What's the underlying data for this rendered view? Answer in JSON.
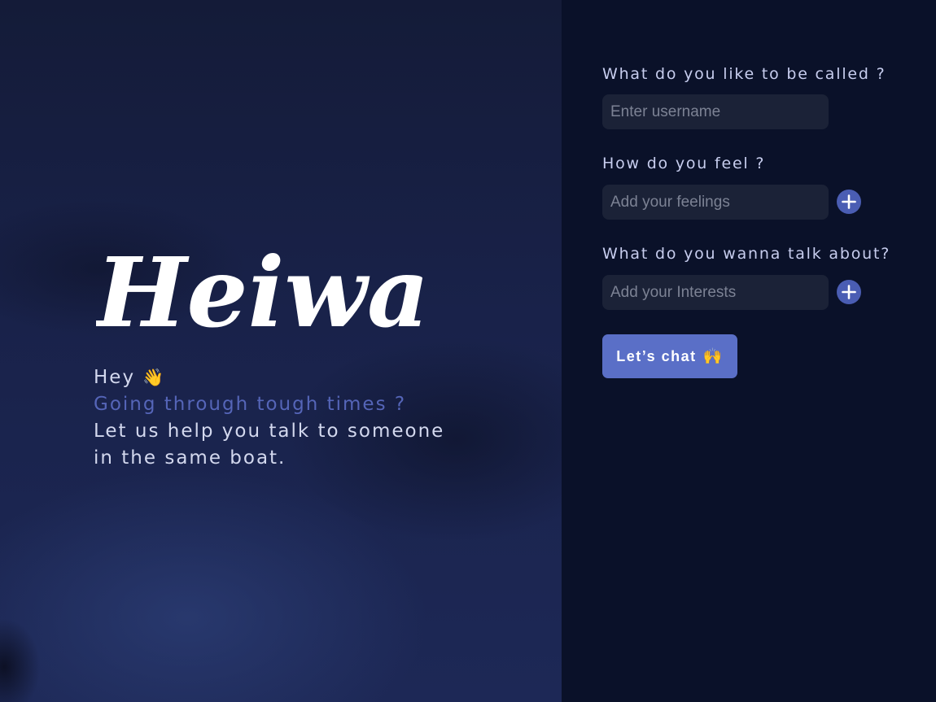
{
  "hero": {
    "logo_text": "Heiwa ...",
    "greeting": "Hey",
    "greeting_emoji": "👋",
    "subtitle": "Going through tough times ?",
    "message_line1": "Let us help you talk to someone",
    "message_line2": "in the same boat."
  },
  "form": {
    "username": {
      "label": "What do you like to be called ?",
      "placeholder": "Enter username",
      "value": ""
    },
    "feelings": {
      "label": "How do you feel ?",
      "placeholder": "Add your feelings",
      "value": "",
      "add_icon": "plus-circle-icon"
    },
    "interests": {
      "label": "What do you wanna talk about?",
      "placeholder": "Add your Interests",
      "value": "",
      "add_icon": "plus-circle-icon"
    },
    "submit": {
      "label": "Let’s chat",
      "emoji": "🙌"
    }
  },
  "colors": {
    "panel_bg": "#0a1129",
    "input_bg": "#1b2237",
    "accent": "#5a6fc7",
    "add_button": "#4a5db3",
    "subtitle": "#5565b8",
    "label": "#c7cdee"
  }
}
